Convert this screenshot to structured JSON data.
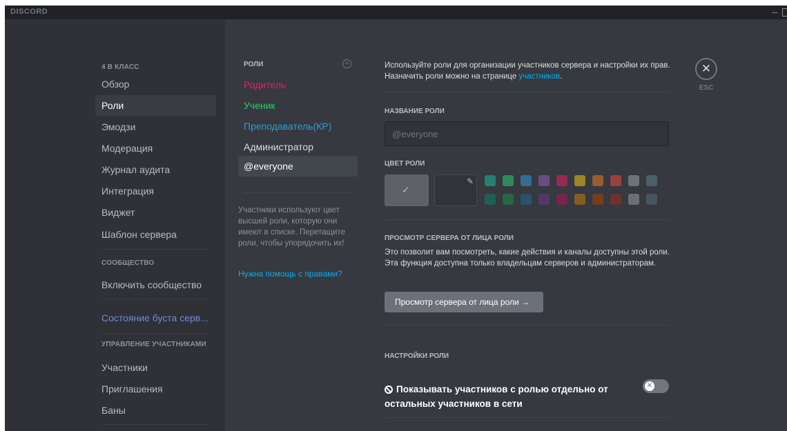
{
  "window": {
    "logo": "DISCORD",
    "minimize": "–"
  },
  "sidebar": {
    "server_header": "4 В КЛАСС",
    "items": [
      {
        "label": "Обзор"
      },
      {
        "label": "Роли"
      },
      {
        "label": "Эмодзи"
      },
      {
        "label": "Модерация"
      },
      {
        "label": "Журнал аудита"
      },
      {
        "label": "Интеграция"
      },
      {
        "label": "Виджет"
      },
      {
        "label": "Шаблон сервера"
      }
    ],
    "community_header": "СООБЩЕСТВО",
    "community_item": "Включить сообщество",
    "boost_item": "Состояние буста серв...",
    "members_header": "УПРАВЛЕНИЕ УЧАСТНИКАМИ",
    "member_items": [
      {
        "label": "Участники"
      },
      {
        "label": "Приглашения"
      },
      {
        "label": "Баны"
      }
    ]
  },
  "roles": {
    "header": "РОЛИ",
    "add_icon": "+",
    "list": [
      {
        "name": "Родитель",
        "color": "#e91e63"
      },
      {
        "name": "Ученик",
        "color": "#2ecc71"
      },
      {
        "name": "Преподаватель(КР)",
        "color": "#3498db"
      },
      {
        "name": "Администратор",
        "color": "#dcddde"
      },
      {
        "name": "@everyone",
        "color": "#ffffff"
      }
    ],
    "note": "Участники используют цвет высшей роли, которую они имеют в списке. Перетащите роли, чтобы упорядочить их!",
    "help_link": "Нужна помощь с правами?"
  },
  "content": {
    "intro_text": "Используйте роли для организации участников сервера и настройки их прав. Назначить роли можно на странице ",
    "intro_link": "участников",
    "intro_end": ".",
    "role_name_label": "НАЗВАНИЕ РОЛИ",
    "role_name_placeholder": "@everyone",
    "role_color_label": "ЦВЕТ РОЛИ",
    "default_color_check": "✓",
    "picker_icon": "✎",
    "swatches_row1": [
      "#1abc9c",
      "#2ecc71",
      "#3498db",
      "#9b59b6",
      "#e91e63",
      "#f1c40f",
      "#e67e22",
      "#e74c3c",
      "#95a5a6",
      "#607d8b"
    ],
    "swatches_row2": [
      "#11806a",
      "#1f8b4c",
      "#206694",
      "#71368a",
      "#ad1457",
      "#c27c0e",
      "#a84300",
      "#992d22",
      "#979c9f",
      "#546e7a"
    ],
    "view_as_label": "ПРОСМОТР СЕРВЕРА ОТ ЛИЦА РОЛИ",
    "view_as_text": "Это позволит вам посмотреть, какие действия и каналы доступны этой роли. Эта функция доступна только владельцам серверов и администраторам.",
    "view_as_button": "Просмотр сервера от лица роли →",
    "settings_label": "НАСТРОЙКИ РОЛИ",
    "setting_icon": "⃠",
    "setting_text": "Показывать участников с ролью отдельно от остальных участников в сети",
    "toggle_icon": "✕"
  },
  "close": {
    "icon": "✕",
    "label": "ESC"
  }
}
